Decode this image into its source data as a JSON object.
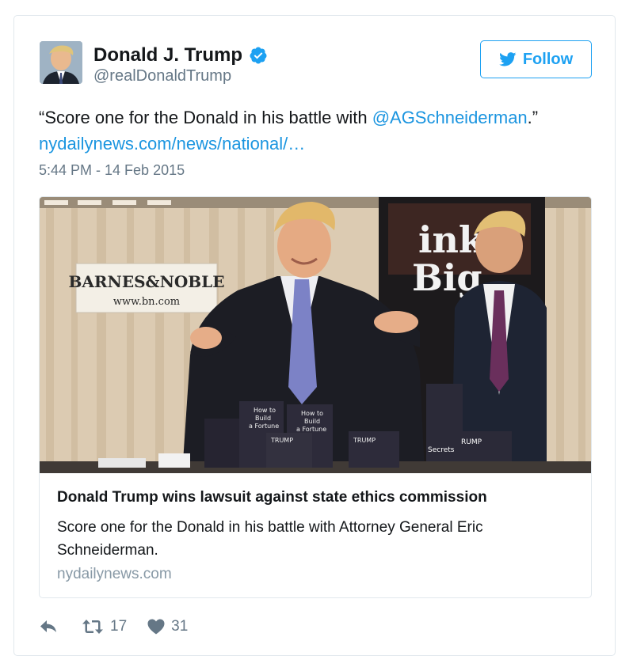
{
  "author": {
    "name": "Donald J. Trump",
    "handle": "@realDonaldTrump",
    "verified": true
  },
  "follow": {
    "label": "Follow",
    "icon": "twitter-bird-icon"
  },
  "tweet": {
    "text_before": "“Score one for the Donald in his battle with ",
    "mention": "@AGSchneiderman",
    "text_middle": ".” ",
    "link": "nydailynews.com/news/national/…",
    "timestamp": "5:44 PM - 14 Feb 2015"
  },
  "card": {
    "image_sign": {
      "line1": "BARNES&NOBLE",
      "line2": "www.bn.com"
    },
    "title": "Donald Trump wins lawsuit against state ethics commission",
    "description": "Score one for the Donald in his battle with Attorney General Eric Schneiderman.",
    "domain": "nydailynews.com"
  },
  "actions": {
    "reply_icon": "reply-icon",
    "retweet_icon": "retweet-icon",
    "retweet_count": "17",
    "like_icon": "heart-icon",
    "like_count": "31"
  },
  "colors": {
    "link": "#1b95e0",
    "follow": "#1da1f2",
    "muted": "#657786",
    "border": "#e1e8ed"
  }
}
